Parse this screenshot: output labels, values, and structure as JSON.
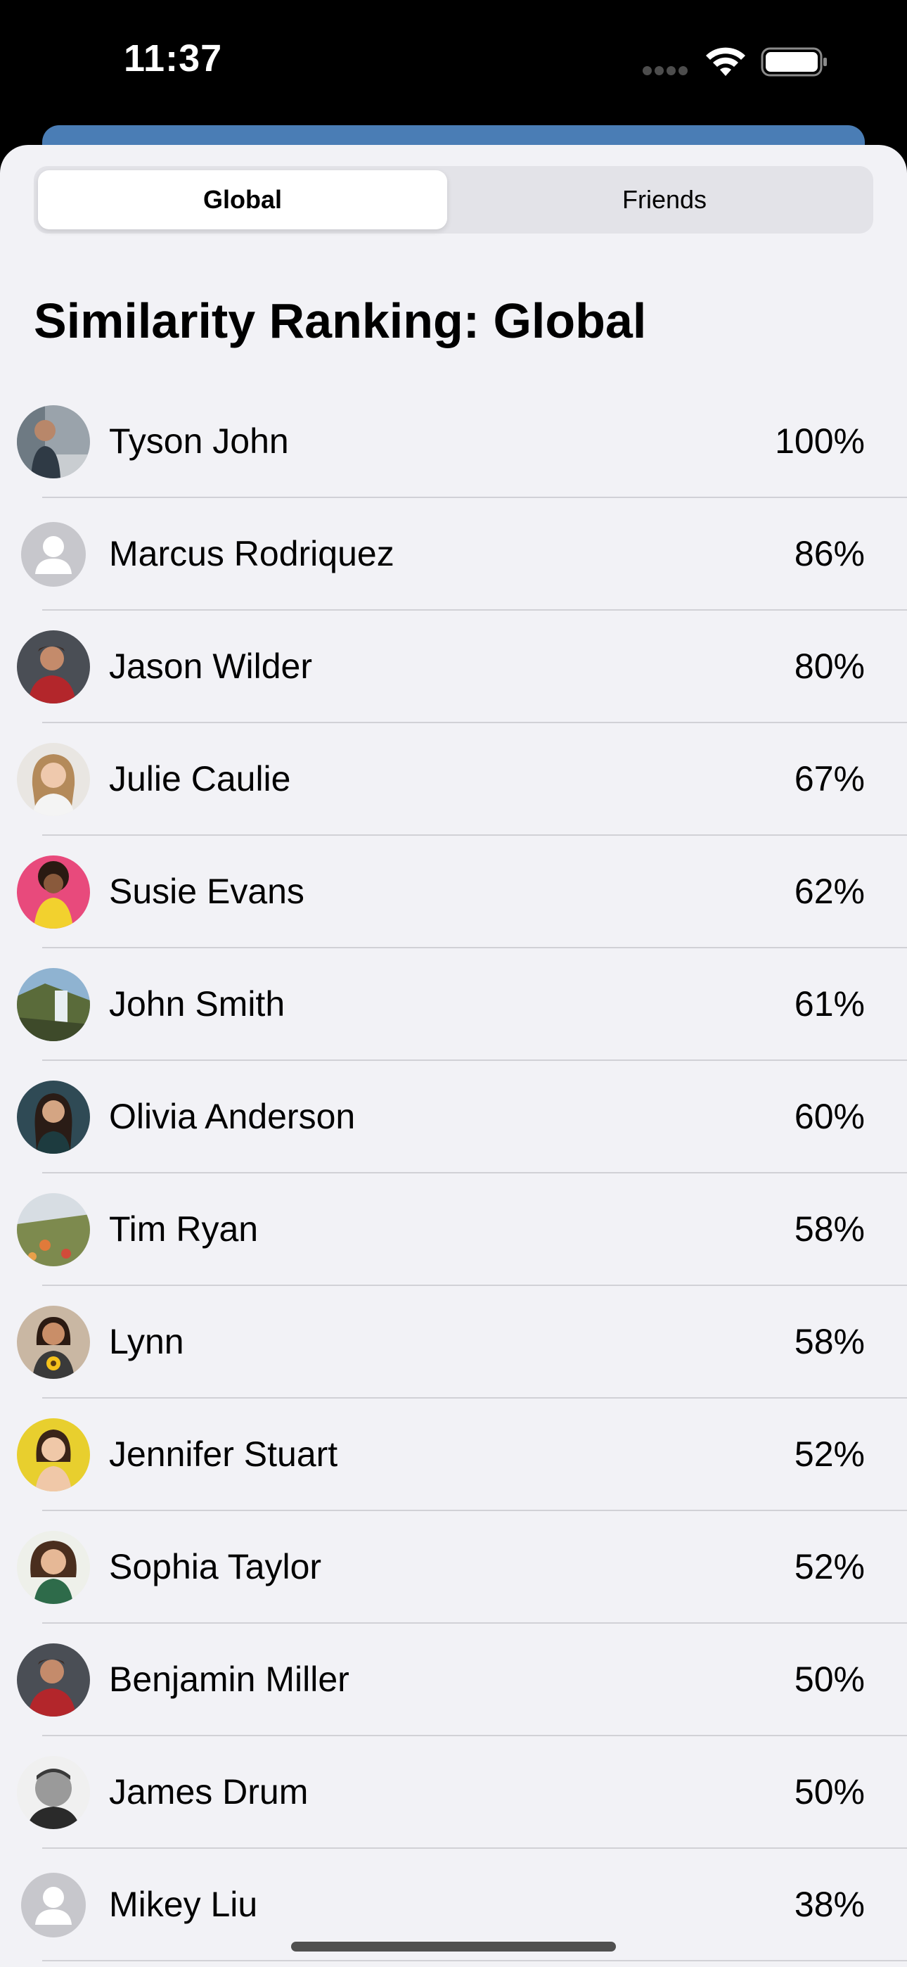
{
  "status_bar": {
    "time": "11:37"
  },
  "segmented_control": {
    "options": [
      "Global",
      "Friends"
    ],
    "selected": "Global"
  },
  "title": "Similarity Ranking: Global",
  "rankings": [
    {
      "name": "Tyson John",
      "similarity": "100%",
      "avatar": "photo"
    },
    {
      "name": "Marcus Rodriquez",
      "similarity": "86%",
      "avatar": "placeholder"
    },
    {
      "name": "Jason Wilder",
      "similarity": "80%",
      "avatar": "photo"
    },
    {
      "name": "Julie Caulie",
      "similarity": "67%",
      "avatar": "photo"
    },
    {
      "name": "Susie Evans",
      "similarity": "62%",
      "avatar": "photo"
    },
    {
      "name": "John Smith",
      "similarity": "61%",
      "avatar": "photo"
    },
    {
      "name": "Olivia Anderson",
      "similarity": "60%",
      "avatar": "photo"
    },
    {
      "name": "Tim Ryan",
      "similarity": "58%",
      "avatar": "photo"
    },
    {
      "name": "Lynn",
      "similarity": "58%",
      "avatar": "photo"
    },
    {
      "name": "Jennifer Stuart",
      "similarity": "52%",
      "avatar": "photo"
    },
    {
      "name": "Sophia Taylor",
      "similarity": "52%",
      "avatar": "photo"
    },
    {
      "name": "Benjamin Miller",
      "similarity": "50%",
      "avatar": "photo"
    },
    {
      "name": "James Drum",
      "similarity": "50%",
      "avatar": "photo"
    },
    {
      "name": "Mikey Liu",
      "similarity": "38%",
      "avatar": "placeholder"
    }
  ],
  "colors": {
    "background": "#f2f2f6",
    "accent_sheet": "#4a7db5",
    "placeholder_avatar": "#c7c7cc",
    "divider": "#d1d1d6"
  }
}
